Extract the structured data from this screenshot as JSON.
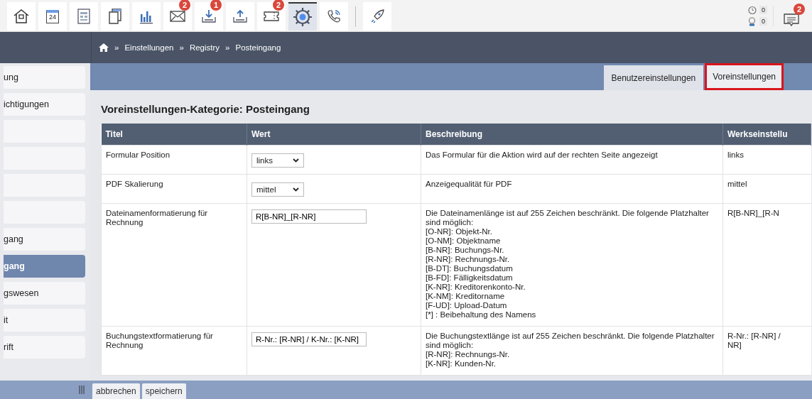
{
  "toolbar": {
    "items": [
      {
        "selected": false
      },
      {
        "label": "24",
        "selected": false
      },
      {
        "selected": false
      },
      {
        "selected": false
      },
      {
        "selected": false
      },
      {
        "badge": "2",
        "selected": false
      },
      {
        "badge": "1",
        "selected": false
      },
      {
        "selected": false
      },
      {
        "badge": "2",
        "selected": false
      },
      {
        "selected": true
      },
      {
        "selected": false
      },
      {
        "selected": false
      }
    ],
    "counters": [
      {
        "value": "0"
      },
      {
        "value": "0"
      }
    ],
    "messages": {
      "badge": "2"
    }
  },
  "breadcrumb": {
    "separator": "»",
    "items": [
      "Einstellungen",
      "Registry",
      "Posteingang"
    ]
  },
  "sidebar": {
    "items": [
      {
        "label": "ung",
        "selected": false
      },
      {
        "label": "ichtigungen",
        "selected": false
      },
      {
        "selected": false
      },
      {
        "selected": false
      },
      {
        "selected": false
      },
      {
        "selected": false
      },
      {
        "label": "gang",
        "selected": false
      },
      {
        "label": "gang",
        "selected": true
      },
      {
        "label": "gswesen",
        "selected": false
      },
      {
        "label": "it",
        "selected": false
      },
      {
        "label": "rift",
        "selected": false
      }
    ]
  },
  "tabs": [
    {
      "label": "Benutzereinstellungen",
      "selected": false,
      "highlighted": false
    },
    {
      "label": "Voreinstellungen",
      "selected": true,
      "highlighted": true
    }
  ],
  "heading": "Voreinstellungen-Kategorie: Posteingang",
  "table": {
    "columns": [
      "Titel",
      "Wert",
      "Beschreibung",
      "Werkseinstellu"
    ],
    "rows": [
      {
        "title": "Formular Position",
        "kind": "select",
        "value": "links",
        "description": [
          "Das Formular für die Aktion wird auf der rechten Seite angezeigt"
        ],
        "default": [
          "links"
        ]
      },
      {
        "title": "PDF Skalierung",
        "kind": "select",
        "value": "mittel",
        "description": [
          "Anzeigequalität für PDF"
        ],
        "default": [
          "mittel"
        ]
      },
      {
        "title": "Dateinamenformatierung für Rechnung",
        "kind": "text",
        "value": "R[B-NR]_[R-NR]",
        "description": [
          "Die Dateinamenlänge ist auf 255 Zeichen beschränkt. Die folgende Platzhalter sind möglich:",
          "[O-NR]: Objekt-Nr.",
          "[O-NM]: Objektname",
          "[B-NR]: Buchungs-Nr.",
          "[R-NR]: Rechnungs-Nr.",
          "[B-DT]: Buchungsdatum",
          "[B-FD]: Fälligkeitsdatum",
          "[K-NR]: Kreditorenkonto-Nr.",
          "[K-NM]: Kreditorname",
          "[F-UD]: Upload-Datum",
          "[*] : Beibehaltung des Namens"
        ],
        "default": [
          "R[B-NR]_[R-N"
        ]
      },
      {
        "title": "Buchungstextformatierung für Rechnung",
        "kind": "text",
        "value": "R-Nr.: [R-NR] / K-Nr.: [K-NR]",
        "description": [
          "Die Buchungstextlänge ist auf 255 Zeichen beschränkt. Die folgende Platzhalter sind möglich:",
          "[R-NR]: Rechnungs-Nr.",
          "[K-NR]: Kunden-Nr."
        ],
        "default": [
          "R-Nr.: [R-NR] /",
          "NR]"
        ]
      }
    ]
  },
  "footer": {
    "buttons": [
      "abbrechen",
      "speichern"
    ]
  }
}
